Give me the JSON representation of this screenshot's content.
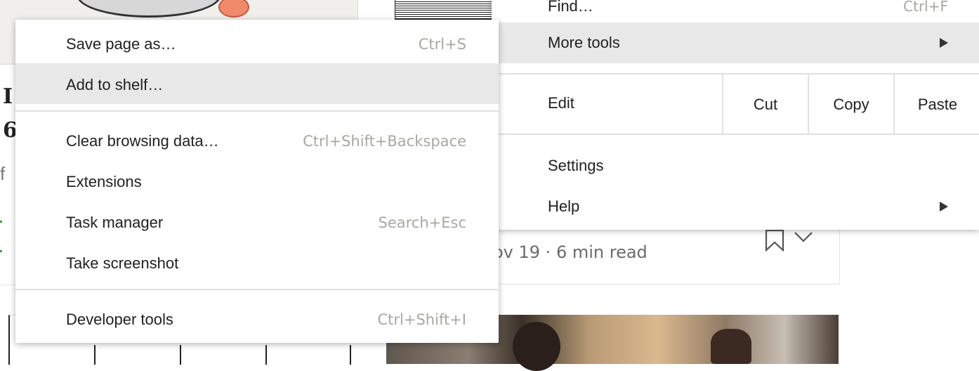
{
  "background_page": {
    "story_meta": "ov 19 · 6 min read",
    "story_author_fragment": "..."
  },
  "main_menu": {
    "find": {
      "label": "Find…",
      "shortcut": "Ctrl+F"
    },
    "more_tools": {
      "label": "More tools"
    },
    "edit": {
      "label": "Edit",
      "cut_label": "Cut",
      "copy_label": "Copy",
      "paste_label": "Paste"
    },
    "settings": {
      "label": "Settings"
    },
    "help": {
      "label": "Help"
    }
  },
  "more_tools_submenu": {
    "items": [
      {
        "label": "Save page as…",
        "shortcut": "Ctrl+S"
      },
      {
        "label": "Add to shelf…",
        "shortcut": ""
      },
      {
        "label": "Clear browsing data…",
        "shortcut": "Ctrl+Shift+Backspace"
      },
      {
        "label": "Extensions",
        "shortcut": ""
      },
      {
        "label": "Task manager",
        "shortcut": "Search+Esc"
      },
      {
        "label": "Take screenshot",
        "shortcut": ""
      },
      {
        "label": "Developer tools",
        "shortcut": "Ctrl+Shift+I"
      }
    ]
  },
  "colors": {
    "menu_background": "#ffffff",
    "highlight": "#e8e8e8",
    "shortcut_text": "#a8a8a0",
    "divider": "#e0e0e0"
  }
}
